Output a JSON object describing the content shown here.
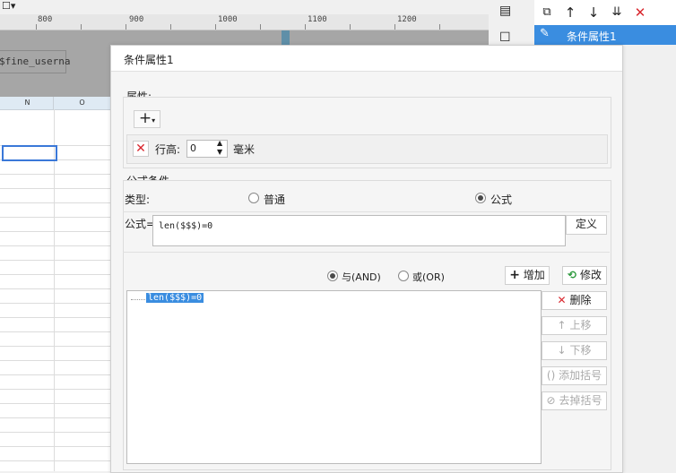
{
  "ruler": {
    "ticks": [
      "800",
      "900",
      "1000",
      "1100",
      "1200"
    ]
  },
  "canvas": {
    "field_text": "$fine_userna"
  },
  "grid": {
    "columns": [
      "N",
      "O"
    ]
  },
  "condition_list": {
    "items": [
      {
        "label": "条件属性1"
      }
    ]
  },
  "dialog": {
    "title": "条件属性1",
    "attributes_label": "属性:",
    "row_height_label": "行高:",
    "row_height_value": "0",
    "row_height_unit": "毫米",
    "formula_condition_label": "公式条件",
    "type_label": "类型:",
    "type_normal": "普通",
    "type_formula": "公式",
    "formula_label": "公式=",
    "formula_value": "len($$$)=0",
    "define_button": "定义",
    "and_label": "与(AND)",
    "or_label": "或(OR)",
    "add_button": "增加",
    "modify_button": "修改",
    "delete_button": "删除",
    "move_up_button": "上移",
    "move_down_button": "下移",
    "add_bracket_button": "添加括号",
    "remove_bracket_button": "去掉括号",
    "condition_entries": [
      "len($$$)=0"
    ]
  },
  "colors": {
    "accent": "#3a8de0",
    "delete_red": "#d9272e"
  }
}
